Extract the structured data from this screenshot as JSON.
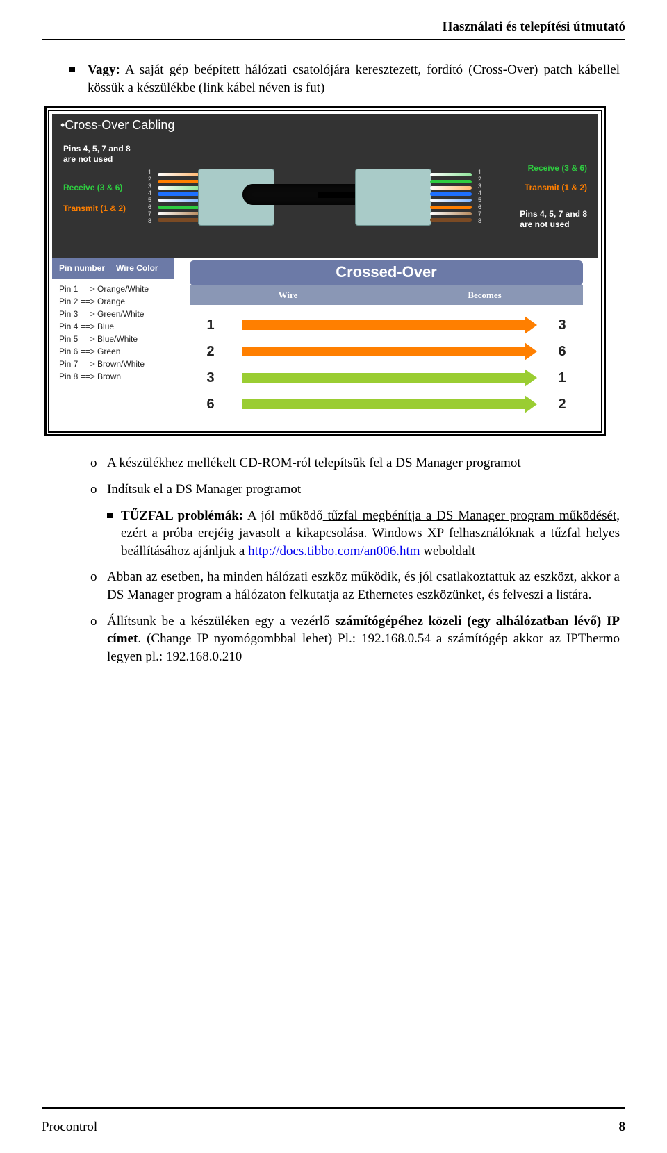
{
  "header": {
    "title": "Használati és telepítési útmutató"
  },
  "intro": {
    "bold": "Vagy:",
    "text": " A saját gép beépített hálózati csatolójára keresztezett, fordító (Cross-Over) patch kábellel kössük a készülékbe (link kábel néven is fut)"
  },
  "diagram": {
    "top_title": "•Cross-Over Cabling",
    "left_pins_unused": "Pins 4, 5, 7 and 8\nare not used",
    "left_receive": "Receive (3 & 6)",
    "left_transmit": "Transmit (1 & 2)",
    "right_receive": "Receive (3 & 6)",
    "right_transmit": "Transmit (1 & 2)",
    "right_pins_unused": "Pins 4, 5, 7 and 8\nare not used",
    "pin_header_left": "Pin number",
    "pin_header_right": "Wire Color",
    "pin_rows": [
      "Pin 1 ==> Orange/White",
      "Pin 2 ==> Orange",
      "Pin 3 ==> Green/White",
      "Pin 4 ==> Blue",
      "Pin 5 ==> Blue/White",
      "Pin 6 ==> Green",
      "Pin 7 ==> Brown/White",
      "Pin 8 ==> Brown"
    ],
    "crossed_title": "Crossed-Over",
    "col_wire": "Wire",
    "col_becomes": "Becomes",
    "map": [
      {
        "from": "1",
        "to": "3"
      },
      {
        "from": "2",
        "to": "6"
      },
      {
        "from": "3",
        "to": "1"
      },
      {
        "from": "6",
        "to": "2"
      }
    ]
  },
  "list": {
    "o1": "A készülékhez mellékelt CD-ROM-ról telepítsük fel a DS Manager programot",
    "o2": "Indítsuk el a DS Manager programot",
    "sub_bold": "TŰZFAL problémák:",
    "sub_rest_a": " A jól működő",
    "sub_underline": " tűzfal megbénítja a DS Manager program működését",
    "sub_rest_b": ", ezért a próba erejéig javasolt a kikapcsolása. Windows XP felhasználóknak a tűzfal helyes beállításához ajánljuk a ",
    "sub_link": "http://docs.tibbo.com/an006.htm",
    "sub_rest_c": " weboldalt",
    "o3": "Abban az esetben, ha minden hálózati eszköz működik, és jól csatlakoztattuk az eszközt, akkor a DS Manager program a hálózaton felkutatja az Ethernetes eszközünket, és felveszi a listára.",
    "o4_a": "Állítsunk be a készüléken egy a vezérlő ",
    "o4_bold": "számítógépéhez közeli (egy alhálózatban lévő) IP címet",
    "o4_b": ". (Change IP nyomógombbal lehet) Pl.: 192.168.0.54 a számítógép akkor az IPThermo legyen pl.: 192.168.0.210"
  },
  "footer": {
    "left": "Procontrol",
    "page": "8"
  }
}
